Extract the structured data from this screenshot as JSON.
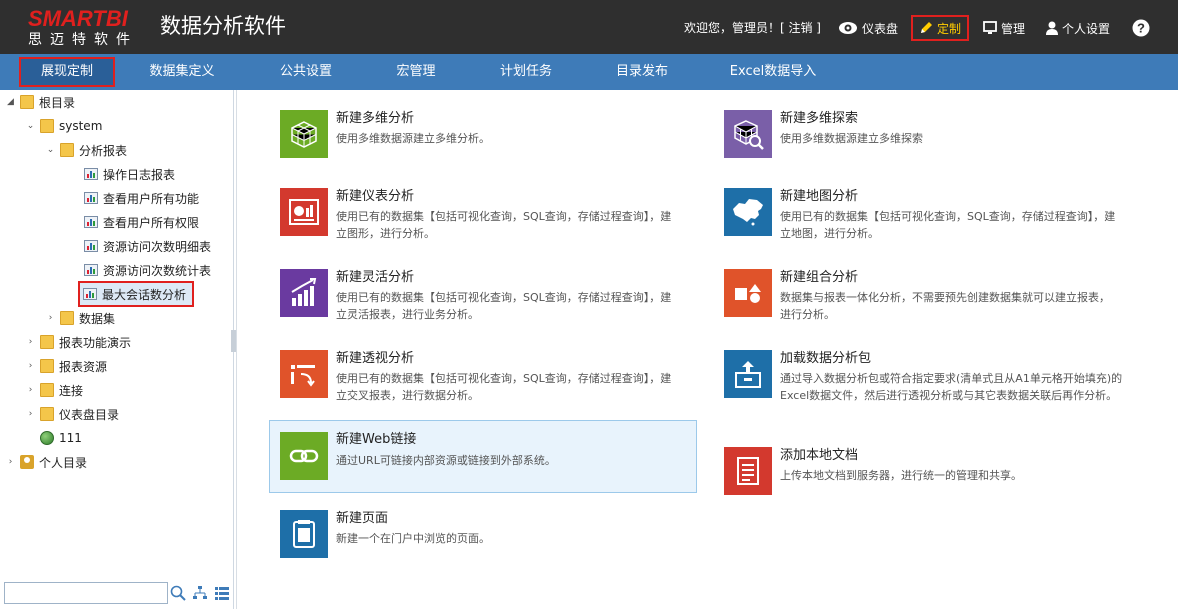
{
  "app": {
    "logo_text": "SMARTBI",
    "logo_sub": "思迈特软件",
    "title": "数据分析软件"
  },
  "topbar": {
    "welcome": "欢迎您，管理员！[ 注销 ]",
    "dashboard": "仪表盘",
    "customize": "定制",
    "manage": "管理",
    "personal": "个人设置"
  },
  "nav": {
    "tabs": [
      "展现定制",
      "数据集定义",
      "公共设置",
      "宏管理",
      "计划任务",
      "目录发布",
      "Excel数据导入"
    ]
  },
  "tree": {
    "root": "根目录",
    "system": "system",
    "analysis_reports": "分析报表",
    "reports": [
      "操作日志报表",
      "查看用户所有功能",
      "查看用户所有权限",
      "资源访问次数明细表",
      "资源访问次数统计表",
      "最大会话数分析"
    ],
    "dataset": "数据集",
    "folders": [
      "报表功能演示",
      "报表资源",
      "连接",
      "仪表盘目录"
    ],
    "item111": "111",
    "personal": "个人目录"
  },
  "cards": [
    {
      "title": "新建多维分析",
      "desc": "使用多维数据源建立多维分析。"
    },
    {
      "title": "新建多维探索",
      "desc": "使用多维数据源建立多维探索"
    },
    {
      "title": "新建仪表分析",
      "desc": "使用已有的数据集【包括可视化查询，SQL查询，存储过程查询】，建立图形，进行分析。"
    },
    {
      "title": "新建地图分析",
      "desc": "使用已有的数据集【包括可视化查询，SQL查询，存储过程查询】，建立地图，进行分析。"
    },
    {
      "title": "新建灵活分析",
      "desc": "使用已有的数据集【包括可视化查询，SQL查询，存储过程查询】，建立灵活报表，进行业务分析。"
    },
    {
      "title": "新建组合分析",
      "desc": "数据集与报表一体化分析，不需要预先创建数据集就可以建立报表，进行分析。"
    },
    {
      "title": "新建透视分析",
      "desc": "使用已有的数据集【包括可视化查询，SQL查询，存储过程查询】，建立交叉报表，进行数据分析。"
    },
    {
      "title": "加载数据分析包",
      "desc": "通过导入数据分析包或符合指定要求(清单式且从A1单元格开始填充)的Excel数据文件，然后进行透视分析或与其它表数据关联后再作分析。"
    },
    {
      "title": "新建Web链接",
      "desc": "通过URL可链接内部资源或链接到外部系统。"
    },
    {
      "title": "添加本地文档",
      "desc": "上传本地文档到服务器，进行统一的管理和共享。"
    },
    {
      "title": "新建页面",
      "desc": "新建一个在门户中浏览的页面。"
    }
  ]
}
